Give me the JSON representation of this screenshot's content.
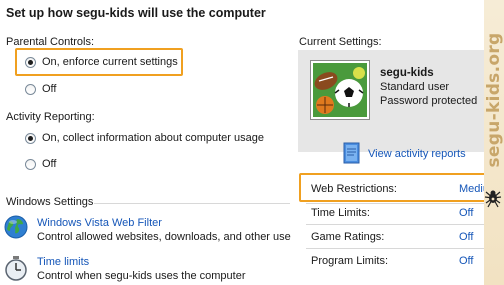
{
  "page_title": "Set up how segu-kids will use the computer",
  "parental_controls": {
    "label": "Parental Controls:",
    "options": [
      {
        "label": "On, enforce current settings",
        "checked": true
      },
      {
        "label": "Off",
        "checked": false
      }
    ]
  },
  "activity_reporting": {
    "label": "Activity Reporting:",
    "options": [
      {
        "label": "On, collect information about computer usage",
        "checked": true
      },
      {
        "label": "Off",
        "checked": false
      }
    ]
  },
  "windows_settings": {
    "label": "Windows Settings",
    "items": [
      {
        "title": "Windows Vista Web Filter",
        "description": "Control allowed websites, downloads, and other use",
        "icon": "globe-icon"
      },
      {
        "title": "Time limits",
        "description": "Control when segu-kids uses the computer",
        "icon": "clock-icon"
      }
    ]
  },
  "current_settings": {
    "label": "Current Settings:",
    "user": {
      "name": "segu-kids",
      "account_type": "Standard user",
      "password_status": "Password protected",
      "avatar_icon": "sports-balls-avatar"
    },
    "view_reports_link": "View activity reports",
    "rows": [
      {
        "label": "Web Restrictions:",
        "value": "Medium"
      },
      {
        "label": "Time Limits:",
        "value": "Off"
      },
      {
        "label": "Game Ratings:",
        "value": "Off"
      },
      {
        "label": "Program Limits:",
        "value": "Off"
      }
    ]
  },
  "watermark": "segu-kids.org",
  "colors": {
    "link": "#1556b8",
    "highlight": "#f0a020",
    "panel": "#e6e6e6"
  }
}
